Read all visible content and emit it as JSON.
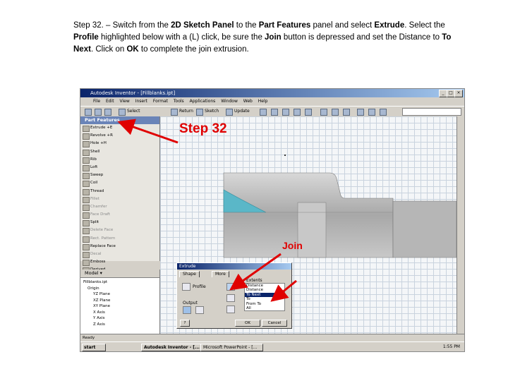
{
  "instruction": {
    "p1": "Step 32. – Switch from the ",
    "b1": "2D Sketch Panel",
    "p2": " to the ",
    "b2": "Part Features",
    "p3": " panel and select ",
    "b3": "Extrude",
    "p4": ". Select the ",
    "b4": "Profile",
    "p5": " highlighted below with a (L) click, be sure the ",
    "b5": "Join",
    "p6": " button is depressed and set the Distance to ",
    "b6": "To Next",
    "p7": ". Click on ",
    "b7": "OK",
    "p8": " to complete the join extrusion."
  },
  "window": {
    "title": "Autodesk Inventor - [Fillblanks.ipt]"
  },
  "menu": [
    "File",
    "Edit",
    "View",
    "Insert",
    "Format",
    "Tools",
    "Applications",
    "Window",
    "Web",
    "Help"
  ],
  "toolbar": {
    "select": "Select",
    "return": "Return",
    "sketch": "Sketch",
    "update": "Update"
  },
  "panel": {
    "header": "Part Features",
    "items": [
      {
        "label": "Extrude    +E",
        "dim": false
      },
      {
        "label": "Revolve   +R",
        "dim": false
      },
      {
        "label": "Hole   +H",
        "dim": false
      },
      {
        "label": "Shell",
        "dim": false
      },
      {
        "label": "Rib",
        "dim": false
      },
      {
        "label": "Loft",
        "dim": false
      },
      {
        "label": "Sweep",
        "dim": false
      },
      {
        "label": "Coil",
        "dim": false
      },
      {
        "label": "Thread",
        "dim": false
      },
      {
        "label": "Fillet",
        "dim": true
      },
      {
        "label": "Chamfer",
        "dim": true
      },
      {
        "label": "Face Draft",
        "dim": true
      },
      {
        "label": "Split",
        "dim": false
      },
      {
        "label": "Delete Face",
        "dim": true
      },
      {
        "label": "Rect. Pattern",
        "dim": true
      },
      {
        "label": "Replace Face",
        "dim": false
      },
      {
        "label": "Decal",
        "dim": true
      },
      {
        "label": "Emboss",
        "dim": false
      },
      {
        "label": "Derived",
        "dim": false
      }
    ]
  },
  "model": {
    "header": "Model ▾",
    "items": [
      "Fillblanks.ipt",
      "Origin",
      "YZ Plane",
      "XZ Plane",
      "XY Plane",
      "X Axis",
      "Y Axis",
      "Z Axis"
    ]
  },
  "dialog": {
    "title": "Extrude",
    "tab_shape": "Shape",
    "tab_more": "More",
    "profile": "Profile",
    "output": "Output",
    "extents": "Extents",
    "extent_options": [
      "Distance",
      "Distance",
      "To Next",
      "To",
      "From To",
      "All"
    ],
    "selected_index": 2,
    "ok": "OK",
    "cancel": "Cancel"
  },
  "status": "Ready",
  "taskbar": {
    "start": "start",
    "task1": "Autodesk Inventor - [...",
    "task2": "Microsoft PowerPoint - [...",
    "clock": "1:55 PM"
  },
  "callouts": {
    "step": "Step 32",
    "join": "Join"
  },
  "colors": {
    "arrow": "#e00000",
    "profile_fill": "#5ab7c8",
    "part_gray": "#b8b8b8"
  }
}
